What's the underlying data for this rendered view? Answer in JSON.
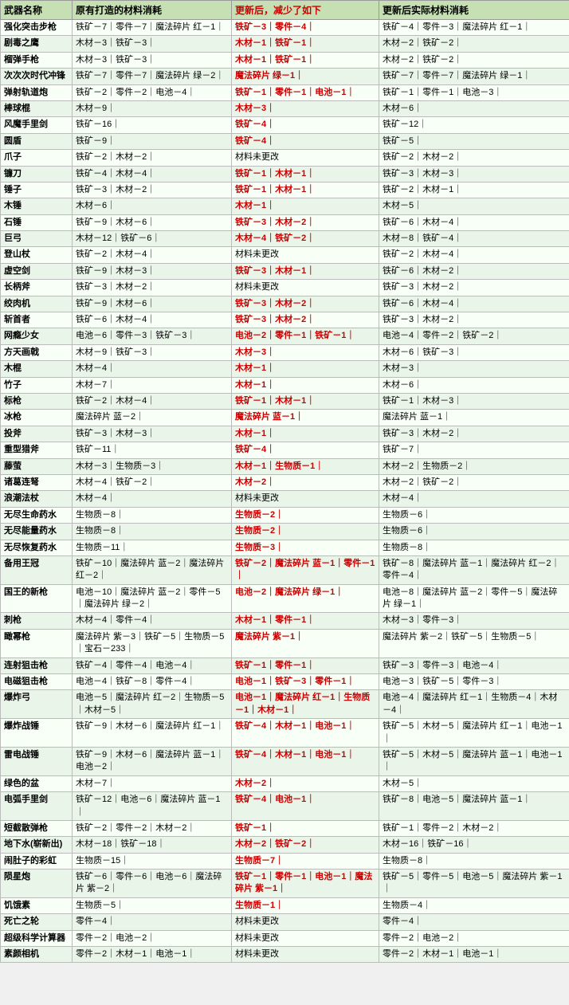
{
  "header": {
    "col1": "武器名称",
    "col2": "原有打造的材料消耗",
    "col3": "更新后，减少了如下",
    "col4": "更新后实际材料消耗"
  },
  "rows": [
    {
      "name": "强化突击步枪",
      "original": "铁矿－7｜零件－7｜魔法碎片 红－1｜",
      "reduced": "铁矿－3｜零件－4｜",
      "actual": "铁矿－4｜零件－3｜魔法碎片 红－1｜"
    },
    {
      "name": "剧毒之鹰",
      "original": "木材－3｜铁矿－3｜",
      "reduced": "木材－1｜铁矿－1｜",
      "actual": "木材－2｜铁矿－2｜"
    },
    {
      "name": "榴弹手枪",
      "original": "木材－3｜铁矿－3｜",
      "reduced": "木材－1｜铁矿－1｜",
      "actual": "木材－2｜铁矿－2｜"
    },
    {
      "name": "次次次时代冲锋",
      "original": "铁矿－7｜零件－7｜魔法碎片 绿－2｜",
      "reduced": "魔法碎片 绿－1｜",
      "actual": "铁矿－7｜零件－7｜魔法碎片 绿－1｜"
    },
    {
      "name": "弹射轨道炮",
      "original": "铁矿－2｜零件－2｜电池－4｜",
      "reduced": "铁矿－1｜零件－1｜电池－1｜",
      "actual": "铁矿－1｜零件－1｜电池－3｜"
    },
    {
      "name": "棒球棍",
      "original": "木材－9｜",
      "reduced": "木材－3｜",
      "actual": "木材－6｜"
    },
    {
      "name": "风魔手里剑",
      "original": "铁矿－16｜",
      "reduced": "铁矿－4｜",
      "actual": "铁矿－12｜"
    },
    {
      "name": "圆盾",
      "original": "铁矿－9｜",
      "reduced": "铁矿－4｜",
      "actual": "铁矿－5｜"
    },
    {
      "name": "爪子",
      "original": "铁矿－2｜木材－2｜",
      "reduced": "材料未更改",
      "actual": "铁矿－2｜木材－2｜",
      "no_change": true
    },
    {
      "name": "镰刀",
      "original": "铁矿－4｜木材－4｜",
      "reduced": "铁矿－1｜木材－1｜",
      "actual": "铁矿－3｜木材－3｜"
    },
    {
      "name": "锤子",
      "original": "铁矿－3｜木材－2｜",
      "reduced": "铁矿－1｜木材－1｜",
      "actual": "铁矿－2｜木材－1｜"
    },
    {
      "name": "木锤",
      "original": "木材－6｜",
      "reduced": "木材－1｜",
      "actual": "木材－5｜"
    },
    {
      "name": "石锤",
      "original": "铁矿－9｜木材－6｜",
      "reduced": "铁矿－3｜木材－2｜",
      "actual": "铁矿－6｜木材－4｜"
    },
    {
      "name": "巨弓",
      "original": "木材－12｜铁矿－6｜",
      "reduced": "木材－4｜铁矿－2｜",
      "actual": "木材－8｜铁矿－4｜"
    },
    {
      "name": "登山杖",
      "original": "铁矿－2｜木材－4｜",
      "reduced": "材料未更改",
      "actual": "铁矿－2｜木材－4｜",
      "no_change": true
    },
    {
      "name": "虚空剑",
      "original": "铁矿－9｜木材－3｜",
      "reduced": "铁矿－3｜木材－1｜",
      "actual": "铁矿－6｜木材－2｜"
    },
    {
      "name": "长柄斧",
      "original": "铁矿－3｜木材－2｜",
      "reduced": "材料未更改",
      "actual": "铁矿－3｜木材－2｜",
      "no_change": true
    },
    {
      "name": "绞肉机",
      "original": "铁矿－9｜木材－6｜",
      "reduced": "铁矿－3｜木材－2｜",
      "actual": "铁矿－6｜木材－4｜"
    },
    {
      "name": "斩首者",
      "original": "铁矿－6｜木材－4｜",
      "reduced": "铁矿－3｜木材－2｜",
      "actual": "铁矿－3｜木材－2｜"
    },
    {
      "name": "网瘾少女",
      "original": "电池－6｜零件－3｜铁矿－3｜",
      "reduced": "电池－2｜零件－1｜铁矿－1｜",
      "actual": "电池－4｜零件－2｜铁矿－2｜"
    },
    {
      "name": "方天画戟",
      "original": "木材－9｜铁矿－3｜",
      "reduced": "木材－3｜",
      "actual": "木材－6｜铁矿－3｜"
    },
    {
      "name": "木棍",
      "original": "木材－4｜",
      "reduced": "木材－1｜",
      "actual": "木材－3｜"
    },
    {
      "name": "竹子",
      "original": "木材－7｜",
      "reduced": "木材－1｜",
      "actual": "木材－6｜"
    },
    {
      "name": "标枪",
      "original": "铁矿－2｜木材－4｜",
      "reduced": "铁矿－1｜木材－1｜",
      "actual": "铁矿－1｜木材－3｜"
    },
    {
      "name": "冰枪",
      "original": "魔法碎片 蓝－2｜",
      "reduced": "魔法碎片 蓝－1｜",
      "actual": "魔法碎片 蓝－1｜"
    },
    {
      "name": "投斧",
      "original": "铁矿－3｜木材－3｜",
      "reduced": "木材－1｜",
      "actual": "铁矿－3｜木材－2｜"
    },
    {
      "name": "重型猎斧",
      "original": "铁矿－11｜",
      "reduced": "铁矿－4｜",
      "actual": "铁矿－7｜"
    },
    {
      "name": "藤萤",
      "original": "木材－3｜生物质－3｜",
      "reduced": "木材－1｜生物质－1｜",
      "actual": "木材－2｜生物质－2｜"
    },
    {
      "name": "诸葛连弩",
      "original": "木材－4｜铁矿－2｜",
      "reduced": "木材－2｜",
      "actual": "木材－2｜铁矿－2｜"
    },
    {
      "name": "浪潮法杖",
      "original": "木材－4｜",
      "reduced": "材料未更改",
      "actual": "木材－4｜",
      "no_change": true
    },
    {
      "name": "无尽生命药水",
      "original": "生物质－8｜",
      "reduced": "生物质－2｜",
      "actual": "生物质－6｜"
    },
    {
      "name": "无尽能量药水",
      "original": "生物质－8｜",
      "reduced": "生物质－2｜",
      "actual": "生物质－6｜"
    },
    {
      "name": "无尽恢复药水",
      "original": "生物质－11｜",
      "reduced": "生物质－3｜",
      "actual": "生物质－8｜"
    },
    {
      "name": "备用王冠",
      "original": "铁矿－10｜魔法碎片 蓝－2｜魔法碎片 红－2｜",
      "reduced": "铁矿－2｜魔法碎片 蓝－1｜零件－1｜",
      "actual": "铁矿－8｜魔法碎片 蓝－1｜魔法碎片 红－2｜零件－4｜"
    },
    {
      "name": "国王的新枪",
      "original": "电池－10｜魔法碎片 蓝－2｜零件－5｜魔法碎片 绿－2｜",
      "reduced": "电池－2｜魔法碎片 绿－1｜",
      "actual": "电池－8｜魔法碎片 蓝－2｜零件－5｜魔法碎片 绿－1｜"
    },
    {
      "name": "刺枪",
      "original": "木材－4｜零件－4｜",
      "reduced": "木材－1｜零件－1｜",
      "actual": "木材－3｜零件－3｜"
    },
    {
      "name": "瞰幂枪",
      "original": "魔法碎片 紫－3｜铁矿－5｜生物质－5｜宝石－233｜",
      "reduced": "魔法碎片 紫－1｜",
      "actual": "魔法碎片 紫－2｜铁矿－5｜生物质－5｜"
    },
    {
      "name": "连射狙击枪",
      "original": "铁矿－4｜零件－4｜电池－4｜",
      "reduced": "铁矿－1｜零件－1｜",
      "actual": "铁矿－3｜零件－3｜电池－4｜"
    },
    {
      "name": "电磁狙击枪",
      "original": "电池－4｜铁矿－8｜零件－4｜",
      "reduced": "电池－1｜铁矿－3｜零件－1｜",
      "actual": "电池－3｜铁矿－5｜零件－3｜"
    },
    {
      "name": "爆炸弓",
      "original": "电池－5｜魔法碎片 红－2｜生物质－5｜木材－5｜",
      "reduced": "电池－1｜魔法碎片 红－1｜生物质－1｜木材－1｜",
      "actual": "电池－4｜魔法碎片 红－1｜生物质－4｜木材－4｜"
    },
    {
      "name": "爆炸战锤",
      "original": "铁矿－9｜木材－6｜魔法碎片 红－1｜",
      "reduced": "铁矿－4｜木材－1｜电池－1｜",
      "actual": "铁矿－5｜木材－5｜魔法碎片 红－1｜电池－1｜"
    },
    {
      "name": "雷电战锤",
      "original": "铁矿－9｜木材－6｜魔法碎片 蓝－1｜电池－2｜",
      "reduced": "铁矿－4｜木材－1｜电池－1｜",
      "actual": "铁矿－5｜木材－5｜魔法碎片 蓝－1｜电池－1｜"
    },
    {
      "name": "绿色的盆",
      "original": "木材－7｜",
      "reduced": "木材－2｜",
      "actual": "木材－5｜"
    },
    {
      "name": "电弧手里剑",
      "original": "铁矿－12｜电池－6｜魔法碎片 蓝－1｜",
      "reduced": "铁矿－4｜电池－1｜",
      "actual": "铁矿－8｜电池－5｜魔法碎片 蓝－1｜"
    },
    {
      "name": "短截散弹枪",
      "original": "铁矿－2｜零件－2｜木材－2｜",
      "reduced": "铁矿－1｜",
      "actual": "铁矿－1｜零件－2｜木材－2｜"
    },
    {
      "name": "地下水(崭新出)",
      "original": "木材－18｜铁矿－18｜",
      "reduced": "木材－2｜铁矿－2｜",
      "actual": "木材－16｜铁矿－16｜"
    },
    {
      "name": "闹肚子的彩虹",
      "original": "生物质－15｜",
      "reduced": "生物质－7｜",
      "actual": "生物质－8｜"
    },
    {
      "name": "陨星炮",
      "original": "铁矿－6｜零件－6｜电池－6｜魔法碎片 紫－2｜",
      "reduced": "铁矿－1｜零件－1｜电池－1｜魔法碎片 紫－1｜",
      "actual": "铁矿－5｜零件－5｜电池－5｜魔法碎片 紫－1｜"
    },
    {
      "name": "饥饿素",
      "original": "生物质－5｜",
      "reduced": "生物质－1｜",
      "actual": "生物质－4｜"
    },
    {
      "name": "死亡之轮",
      "original": "零件－4｜",
      "reduced": "材料未更改",
      "actual": "零件－4｜",
      "no_change": true
    },
    {
      "name": "超级科学计算器",
      "original": "零件－2｜电池－2｜",
      "reduced": "材料未更改",
      "actual": "零件－2｜电池－2｜",
      "no_change": true
    },
    {
      "name": "素颜相机",
      "original": "零件－2｜木材－1｜电池－1｜",
      "reduced": "材料未更改",
      "actual": "零件－2｜木材－1｜电池－1｜",
      "no_change": true
    }
  ]
}
